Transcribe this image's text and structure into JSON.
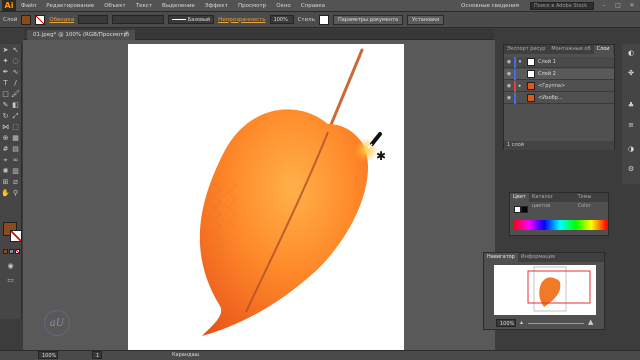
{
  "app": {
    "logo": "Ai"
  },
  "menu": [
    "Файл",
    "Редактирование",
    "Объект",
    "Текст",
    "Выделение",
    "Эффект",
    "Просмотр",
    "Окно",
    "Справка"
  ],
  "menu_right": {
    "workspace": "Основные сведения",
    "search_placeholder": "Поиск в Adobe Stock"
  },
  "control": {
    "selection_label": "Слой",
    "fill_color": "#8c4a1f",
    "opacity_label": "Обводка",
    "stroke_profile": "Базовый",
    "opacity_link": "Непрозрачность",
    "opacity_value": "100%",
    "style_label": "Стиль",
    "doc_setup": "Параметры документа",
    "prefs": "Установки"
  },
  "document": {
    "tab_title": "01.jpeg* @ 100% (RGB/Просмотр)"
  },
  "status": {
    "zoom": "100%",
    "page": "1",
    "tool": "Карандаш"
  },
  "layers_panel": {
    "tabs": [
      "Экспорт ресур",
      "Монтажные об",
      "Слои"
    ],
    "rows": [
      {
        "name": "Слой 1",
        "color": "#3c6ef0"
      },
      {
        "name": "Слой 2",
        "color": "#3c6ef0"
      },
      {
        "name": "<Группа>",
        "color": "#e04040"
      },
      {
        "name": "<Изобр...",
        "color": "#3c6ef0"
      }
    ],
    "footer": "1 слой"
  },
  "color_panel": {
    "tabs": [
      "Цвет",
      "Каталог цветов",
      "Темы Color"
    ]
  },
  "navigator_panel": {
    "tabs": [
      "Навигатор",
      "Информация"
    ],
    "zoom": "100%"
  },
  "colors": {
    "leaf_dark": "#e8541a",
    "leaf_light": "#ffa23a",
    "vein": "#b4522a",
    "stem": "#c86a3a"
  }
}
